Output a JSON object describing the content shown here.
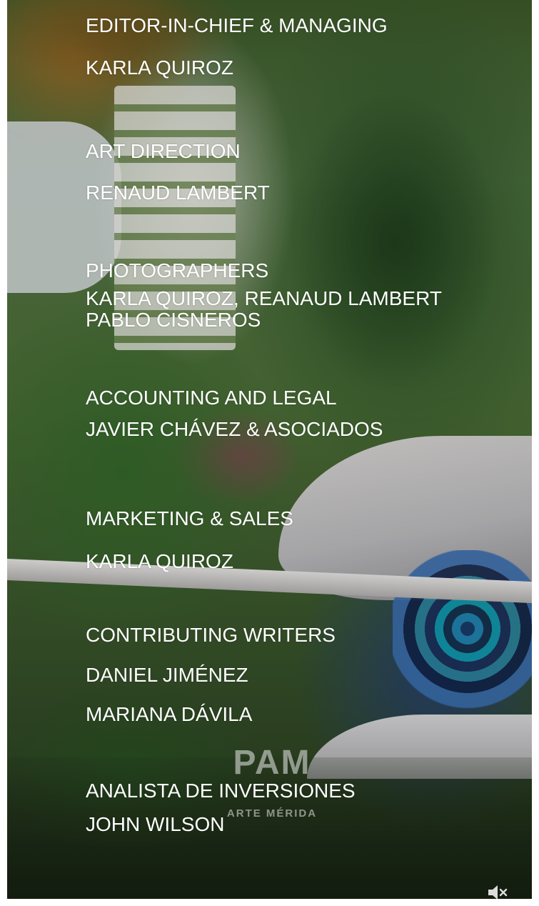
{
  "background": {
    "logo_mark": "PAM",
    "logo_subtitle": "ARTE MÉRIDA"
  },
  "credits": [
    {
      "role": "EDITOR-IN-CHIEF & MANAGING",
      "names": [
        "KARLA QUIROZ"
      ]
    },
    {
      "role": "ART DIRECTION",
      "names": [
        "RENAUD LAMBERT"
      ]
    },
    {
      "role": "PHOTOGRAPHERS",
      "names": [
        "KARLA QUIROZ, REANAUD LAMBERT",
        "PABLO CISNEROS"
      ]
    },
    {
      "role": "ACCOUNTING AND LEGAL",
      "names": [
        "JAVIER CHÁVEZ & ASOCIADOS"
      ]
    },
    {
      "role": "MARKETING & SALES",
      "names": [
        "KARLA QUIROZ"
      ]
    },
    {
      "role": "CONTRIBUTING WRITERS",
      "names": [
        "DANIEL JIMÉNEZ",
        "MARIANA DÁVILA"
      ]
    },
    {
      "role": "ANALISTA DE INVERSIONES",
      "names": [
        "JOHN WILSON"
      ]
    }
  ],
  "controls": {
    "mute_icon": "speaker-muted-icon"
  },
  "colors": {
    "text": "#ffffff"
  }
}
